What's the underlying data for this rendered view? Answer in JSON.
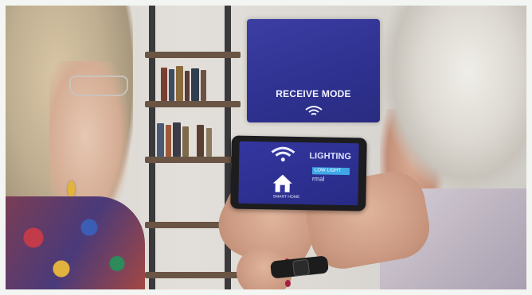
{
  "scene": {
    "tv": {
      "label": "RECEIVE MODE",
      "icon": "wifi-icon"
    },
    "tablet": {
      "title": "LIGHTING",
      "options": [
        "LOW LIGHT",
        "rmal"
      ],
      "selected": "LOW LIGHT",
      "home_label": "SMART HOME",
      "icons": [
        "wifi-icon",
        "home-icon"
      ]
    }
  },
  "colors": {
    "screen_blue": "#2e318f",
    "highlight": "#3fa7e6",
    "white": "#f2f3ff"
  }
}
